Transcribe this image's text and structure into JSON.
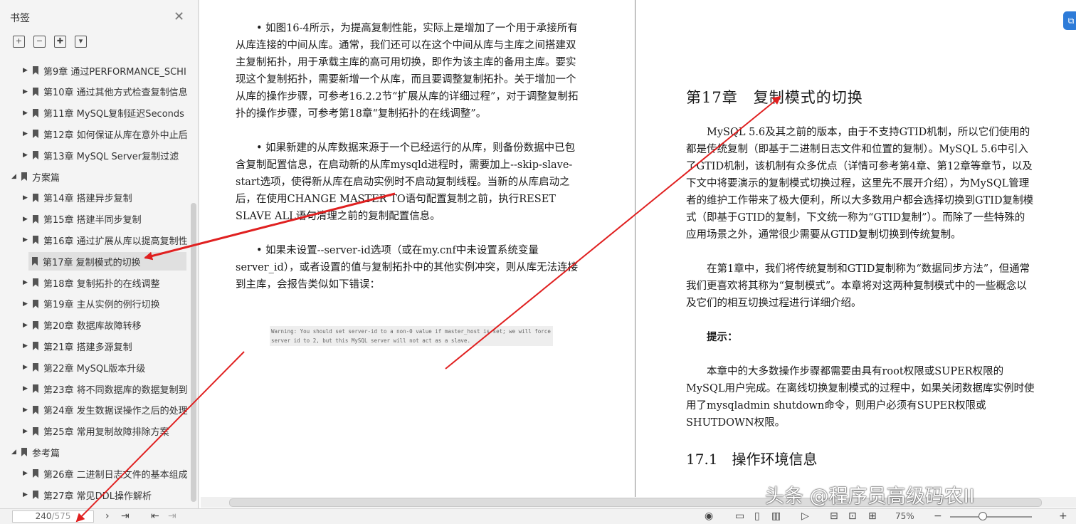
{
  "sidebar": {
    "title": "书签",
    "items": [
      {
        "label": "第9章 通过PERFORMANCE_SCHI",
        "level": 2,
        "selected": false
      },
      {
        "label": "第10章 通过其他方式检查复制信息",
        "level": 2,
        "selected": false
      },
      {
        "label": "第11章 MySQL复制延迟Seconds",
        "level": 2,
        "selected": false
      },
      {
        "label": "第12章 如何保证从库在意外中止后",
        "level": 2,
        "selected": false
      },
      {
        "label": "第13章 MySQL Server复制过滤",
        "level": 2,
        "selected": false
      },
      {
        "label": "方案篇",
        "level": 1,
        "selected": false
      },
      {
        "label": "第14章 搭建异步复制",
        "level": 2,
        "selected": false
      },
      {
        "label": "第15章 搭建半同步复制",
        "level": 2,
        "selected": false
      },
      {
        "label": "第16章 通过扩展从库以提高复制性",
        "level": 2,
        "selected": false
      },
      {
        "label": "第17章 复制模式的切换",
        "level": 2,
        "selected": true
      },
      {
        "label": "第18章 复制拓扑的在线调整",
        "level": 2,
        "selected": false
      },
      {
        "label": "第19章 主从实例的例行切换",
        "level": 2,
        "selected": false
      },
      {
        "label": "第20章 数据库故障转移",
        "level": 2,
        "selected": false
      },
      {
        "label": "第21章 搭建多源复制",
        "level": 2,
        "selected": false
      },
      {
        "label": "第22章 MySQL版本升级",
        "level": 2,
        "selected": false
      },
      {
        "label": "第23章 将不同数据库的数据复制到",
        "level": 2,
        "selected": false
      },
      {
        "label": "第24章 发生数据误操作之后的处理",
        "level": 2,
        "selected": false
      },
      {
        "label": "第25章 常用复制故障排除方案",
        "level": 2,
        "selected": false
      },
      {
        "label": "参考篇",
        "level": 1,
        "selected": false
      },
      {
        "label": "第26章 二进制日志文件的基本组成",
        "level": 2,
        "selected": false
      },
      {
        "label": "第27章 常见DDL操作解析",
        "level": 2,
        "selected": false
      }
    ]
  },
  "left_page": {
    "paragraphs": [
      "• 如图16-4所示，为提高复制性能，实际上是增加了一个用于承接所有从库连接的中间从库。通常，我们还可以在这个中间从库与主库之间搭建双主复制拓扑，用于承载主库的高可用切换，即作为该主库的备用主库。要实现这个复制拓扑，需要新增一个从库，而且要调整复制拓扑。关于增加一个从库的操作步骤，可参考16.2.2节“扩展从库的详细过程”，对于调整复制拓扑的操作步骤，可参考第18章“复制拓扑的在线调整”。",
      "• 如果新建的从库数据来源于一个已经运行的从库，则备份数据中已包含复制配置信息，在启动新的从库mysqld进程时，需要加上--skip-slave-start选项，使得新从库在启动实例时不启动复制线程。当新的从库启动之后，在使用CHANGE MASTER TO语句配置复制之前，执行RESET SLAVE ALL语句清理之前的复制配置信息。",
      "• 如果未设置--server-id选项（或在my.cnf中未设置系统变量server_id），或者设置的值与复制拓扑中的其他实例冲突，则从库无法连接到主库，会报告类似如下错误："
    ],
    "warning": "Warning: You should set server-id to a non-0 value if master_host is set; we will force server id to 2, but this MySQL server will not act as a slave."
  },
  "right_page": {
    "chapter_title": "第17章　复制模式的切换",
    "p1": "MySQL 5.6及其之前的版本，由于不支持GTID机制，所以它们使用的都是传统复制（即基于二进制日志文件和位置的复制）。MySQL 5.6中引入了GTID机制，该机制有众多优点（详情可参考第4章、第12章等章节，以及下文中将要演示的复制模式切换过程，这里先不展开介绍），为MySQL管理者的维护工作带来了极大便利，所以大多数用户都会选择切换到GTID复制模式（即基于GTID的复制，下文统一称为“GTID复制”）。而除了一些特殊的应用场景之外，通常很少需要从GTID复制切换到传统复制。",
    "p2": "在第1章中，我们将传统复制和GTID复制称为“数据同步方法”，但通常我们更喜欢将其称为“复制模式”。本章将对这两种复制模式中的一些概念以及它们的相互切换过程进行详细介绍。",
    "tip_label": "提示：",
    "p3": "本章中的大多数操作步骤都需要由具有root权限或SUPER权限的MySQL用户完成。在离线切换复制模式的过程中，如果关闭数据库实例时使用了mysqladmin shutdown命令，则用户必须有SUPER权限或SHUTDOWN权限。",
    "section_title": "17.1　操作环境信息"
  },
  "statusbar": {
    "current_page": "240",
    "total_pages": "/575",
    "zoom": "75%",
    "zoom_level": 0.4
  },
  "watermark": "头条 @程序员高级码农II",
  "colors": {
    "arrow": "#e02020",
    "selected_bg": "#e0e0e0",
    "float_widget": "#2d7bd8"
  }
}
